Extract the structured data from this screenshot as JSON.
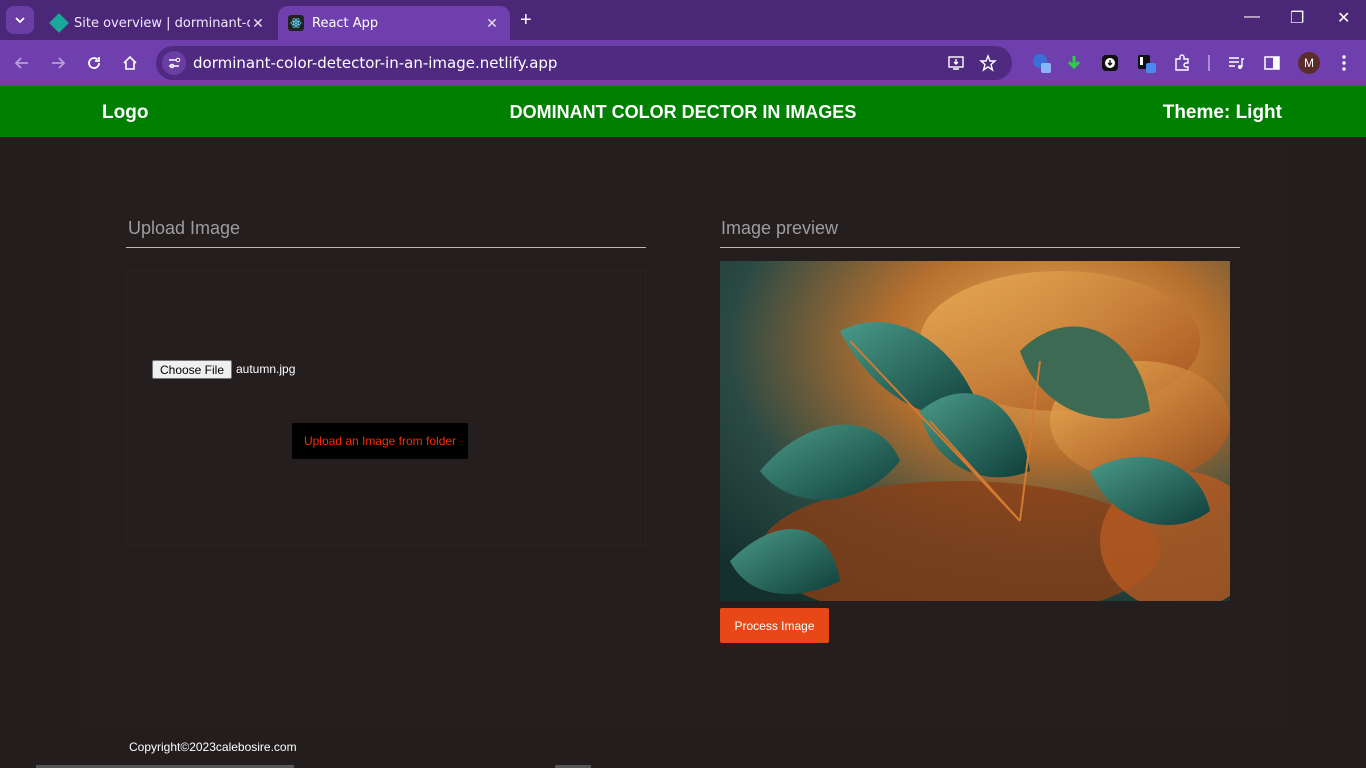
{
  "browser": {
    "tabs": [
      {
        "title": "Site overview | dorminant-color",
        "favicon": "netlify-diamond-icon",
        "active": false
      },
      {
        "title": "React App",
        "favicon": "react-icon",
        "active": true
      }
    ],
    "url": "dorminant-color-detector-in-an-image.netlify.app",
    "profile_initial": "M",
    "colors": {
      "tabbar": "#4b2777",
      "toolbar": "#6f3fae"
    }
  },
  "header": {
    "logo": "Logo",
    "title": "DOMINANT COLOR DECTOR IN IMAGES",
    "theme": "Theme: Light",
    "color": "#008000"
  },
  "upload": {
    "title": "Upload Image",
    "choose_file_label": "Choose File",
    "file_name": "autumn.jpg",
    "upload_button": "Upload an Image from folder"
  },
  "preview": {
    "title": "Image preview",
    "process_button": "Process Image",
    "process_color": "#e84817"
  },
  "footer": {
    "copyright": "Copyright©2023calebosire.com"
  }
}
